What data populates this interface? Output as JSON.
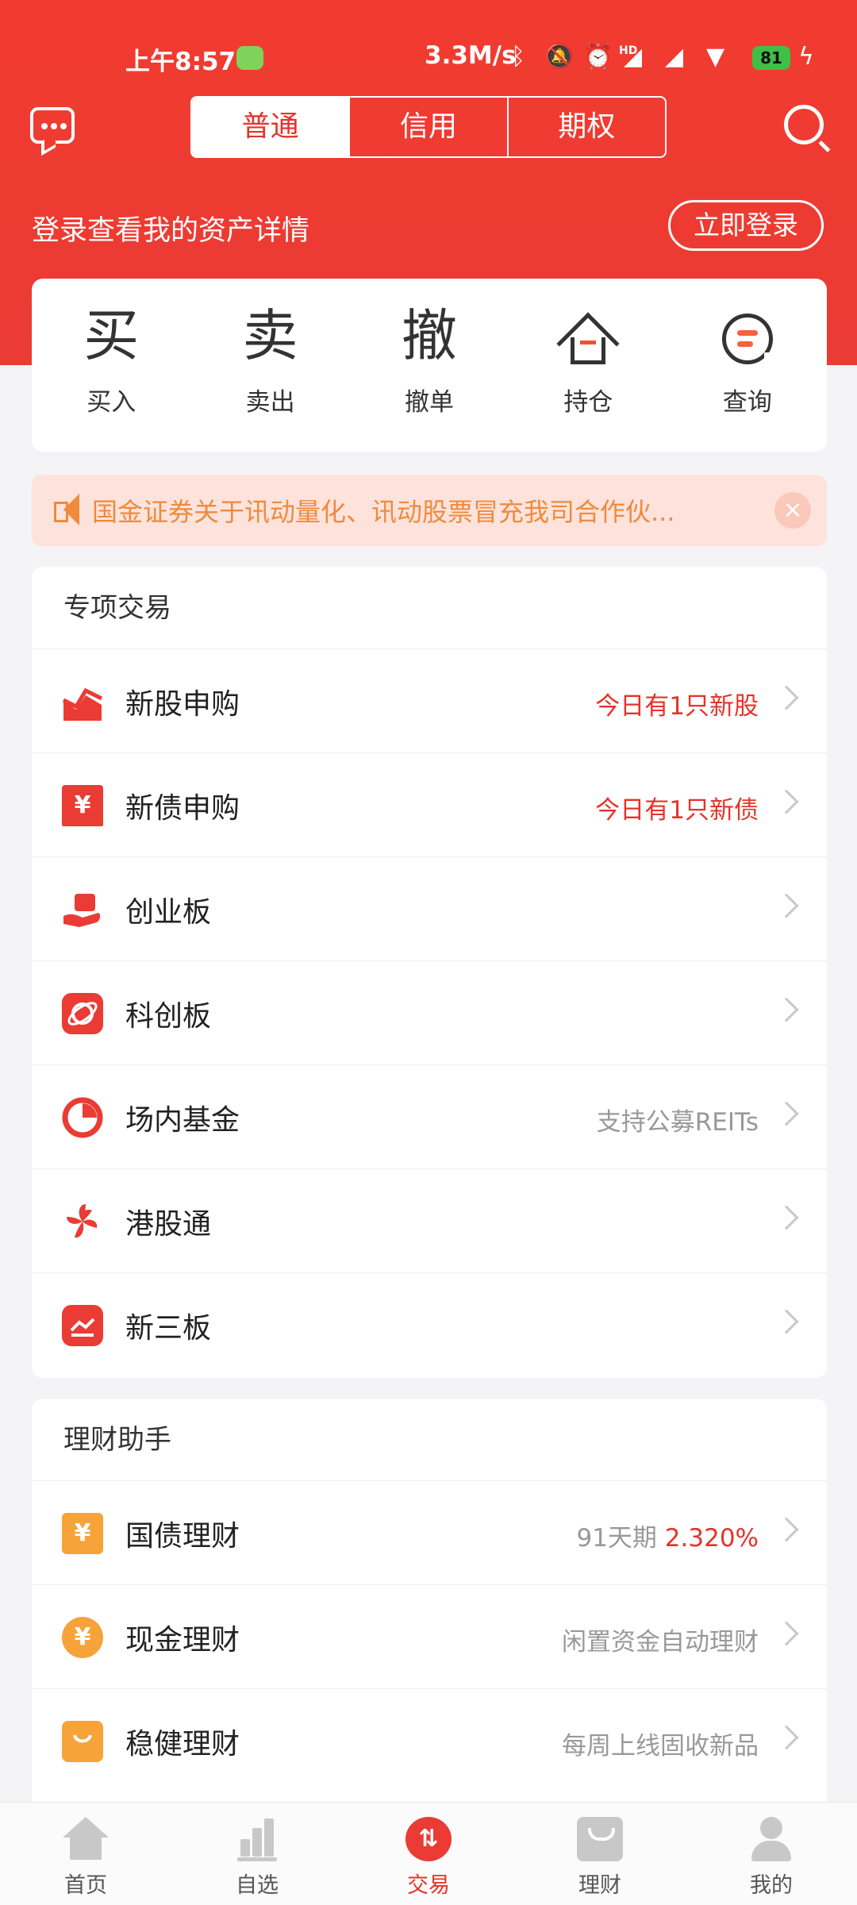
{
  "status_bar": {
    "time": "上午8:57",
    "network_rate": "3.3M/s",
    "hd_label": "HD",
    "battery": "81"
  },
  "header": {
    "tabs": [
      {
        "label": "普通",
        "active": true
      },
      {
        "label": "信用",
        "active": false
      },
      {
        "label": "期权",
        "active": false
      }
    ],
    "login_prompt": "登录查看我的资产详情",
    "login_button": "立即登录"
  },
  "quick_actions": [
    {
      "glyph": "买",
      "label": "买入"
    },
    {
      "glyph": "卖",
      "label": "卖出"
    },
    {
      "glyph": "撤",
      "label": "撤单"
    },
    {
      "glyph": "",
      "label": "持仓",
      "icon": "house-icon"
    },
    {
      "glyph": "",
      "label": "查询",
      "icon": "query-icon"
    }
  ],
  "notice": {
    "text": "国金证券关于讯动量化、讯动股票冒充我司合作伙...",
    "color": "#f08a3c"
  },
  "special_trading": {
    "title": "专项交易",
    "items": [
      {
        "label": "新股申购",
        "right": "今日有1只新股",
        "icon": "ipo-chart-icon"
      },
      {
        "label": "新债申购",
        "right": "今日有1只新债",
        "icon": "bond-yen-icon"
      },
      {
        "label": "创业板",
        "right": "",
        "icon": "gem-hand-icon"
      },
      {
        "label": "科创板",
        "right": "",
        "icon": "star-planet-icon"
      },
      {
        "label": "场内基金",
        "right": "支持公募REITs",
        "icon": "pie-fund-icon"
      },
      {
        "label": "港股通",
        "right": "",
        "icon": "bauhinia-icon"
      },
      {
        "label": "新三板",
        "right": "",
        "icon": "trend-board-icon"
      }
    ]
  },
  "wealth_assistant": {
    "title": "理财助手",
    "items": [
      {
        "label": "国债理财",
        "right_prefix": "91天期",
        "right_value": "2.320%",
        "icon": "ticket-yen-icon"
      },
      {
        "label": "现金理财",
        "right": "闲置资金自动理财",
        "icon": "coin-yen-icon"
      },
      {
        "label": "稳健理财",
        "right": "每周上线固收新品",
        "icon": "shop-bag-icon"
      }
    ]
  },
  "bottom_nav": [
    {
      "label": "首页",
      "icon": "home-icon",
      "active": false
    },
    {
      "label": "自选",
      "icon": "bars-icon",
      "active": false
    },
    {
      "label": "交易",
      "icon": "trade-arrows-icon",
      "active": true
    },
    {
      "label": "理财",
      "icon": "bag-icon",
      "active": false
    },
    {
      "label": "我的",
      "icon": "user-icon",
      "active": false
    }
  ],
  "colors": {
    "brand_red": "#ea3b34",
    "accent_orange": "#f6a33a"
  }
}
